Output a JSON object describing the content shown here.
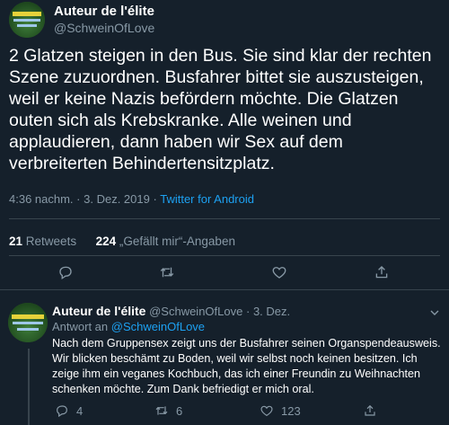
{
  "tweet": {
    "author_name": "Auteur de l'élite",
    "author_handle": "@SchweinOfLove",
    "text": "2 Glatzen steigen in den Bus. Sie sind klar der rechten Szene zuzuordnen. Busfahrer bittet sie auszusteigen, weil er keine Nazis befördern möchte. Die Glatzen outen sich als Krebskranke. Alle weinen und applaudieren, dann haben wir Sex auf dem verbreiterten Behindertensitzplatz.",
    "time": "4:36 nachm.",
    "separator": "·",
    "date": "3. Dez. 2019",
    "source": "Twitter for Android",
    "retweets_count": "21",
    "retweets_label": "Retweets",
    "likes_count": "224",
    "likes_label": "„Gefällt mir“-Angaben"
  },
  "reply": {
    "author_name": "Auteur de l'élite",
    "author_handle": "@SchweinOfLove",
    "separator": "·",
    "date": "3. Dez.",
    "reply_to_label": "Antwort an",
    "reply_to_handle": "@SchweinOfLove",
    "text": "Nach dem Gruppensex zeigt uns der Busfahrer seinen Organspendeausweis. Wir blicken beschämt zu Boden, weil wir selbst noch keinen besitzen. Ich zeige ihm ein veganes Kochbuch, das ich einer Freundin zu Weihnachten schenken möchte. Zum Dank befriedigt er mich oral.",
    "reply_count": "4",
    "retweet_count": "6",
    "like_count": "123"
  },
  "colors": {
    "background": "#15202b",
    "text": "#ffffff",
    "secondary": "#8899a6",
    "link": "#1da1f2",
    "divider": "#38444d"
  },
  "icons": [
    "avatar-image",
    "reply-icon",
    "retweet-icon",
    "like-icon",
    "share-icon",
    "chevron-down-icon"
  ]
}
